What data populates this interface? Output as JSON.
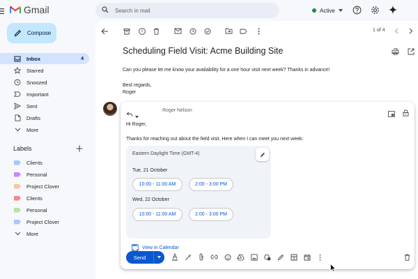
{
  "app": {
    "name": "Gmail"
  },
  "search": {
    "placeholder": "Search in mail"
  },
  "status": {
    "label": "Active",
    "color": "#1e8e3e"
  },
  "compose": {
    "label": "Compose"
  },
  "nav": [
    {
      "label": "Inbox",
      "count": "4",
      "icon": "inbox-icon"
    },
    {
      "label": "Starred",
      "icon": "star-icon"
    },
    {
      "label": "Snoozed",
      "icon": "clock-icon"
    },
    {
      "label": "Important",
      "icon": "important-icon"
    },
    {
      "label": "Sent",
      "icon": "send-icon"
    },
    {
      "label": "Drafts",
      "icon": "draft-icon"
    },
    {
      "label": "More",
      "icon": "chevron-down-icon"
    }
  ],
  "labels": {
    "heading": "Labels",
    "items": [
      {
        "label": "Clients",
        "color": "#a8c7fa"
      },
      {
        "label": "Personal",
        "color": "#c58af9"
      },
      {
        "label": "Project Clover",
        "color": "#f6c89f"
      },
      {
        "label": "Clients",
        "color": "#ee8b8b"
      },
      {
        "label": "Personal",
        "color": "#b5e3a7"
      },
      {
        "label": "Project Clover",
        "color": "#a8c7fa"
      },
      {
        "label": "More"
      }
    ]
  },
  "pager": {
    "text": "1 of 4"
  },
  "email": {
    "subject": "Scheduling Field Visit: Acme Building Site",
    "body": "Can you please let me know your availability for a one hour visit next week? Thanks in advance!",
    "signoff": "Best regards,",
    "signature": "Roger"
  },
  "reply": {
    "to": "Roger Nelson",
    "greeting": "Hi Roger,",
    "line": "Thanks for reaching out about the field visit. Here when I can meet you next week:",
    "timezone": "Eastern Daylight Time (GMT-4)",
    "days": [
      {
        "date": "Tue, 21 October",
        "slots": [
          "10:00 - 11:00 AM",
          "2:00 - 3:00 PM"
        ]
      },
      {
        "date": "Wed, 22 October",
        "slots": [
          "10:00 - 11:00 AM",
          "2:00 - 3:00 PM"
        ]
      }
    ],
    "calendar_link": "View in Calendar",
    "send_label": "Send"
  },
  "colors": {
    "accent": "#0b57d0",
    "compose_bg": "#c2e7ff",
    "active_nav": "#d3e3fd"
  }
}
